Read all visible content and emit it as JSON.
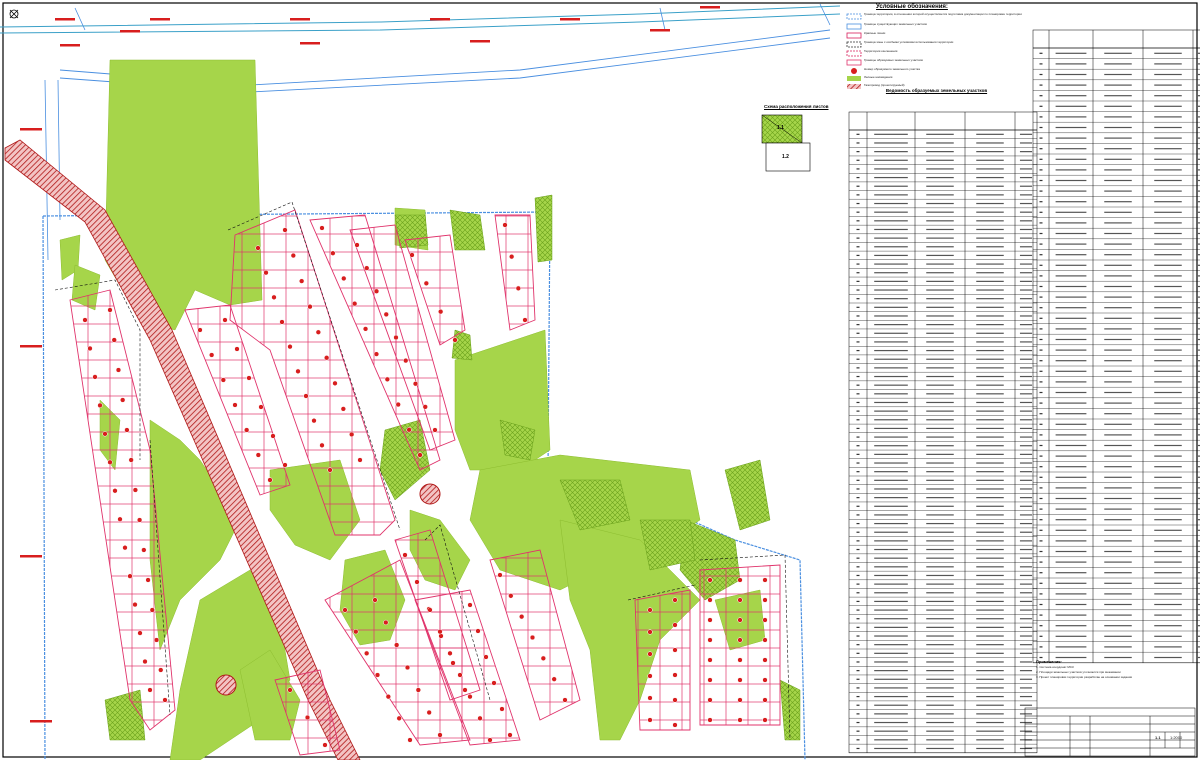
{
  "legend": {
    "title": "Условные обозначения:",
    "items": [
      {
        "label": "Граница территории, в отношении которой осуществляется подготовка документации по планировке территории",
        "kind": "boundary"
      },
      {
        "label": "Границы существующих земельных участков",
        "kind": "cadastral"
      },
      {
        "label": "Красные линии",
        "kind": "red-line"
      },
      {
        "label": "Граница зоны с особыми условиями использования территории",
        "kind": "zone"
      },
      {
        "label": "Территория озеленения",
        "kind": "zone2"
      },
      {
        "label": "Границы образуемых земельных участков",
        "kind": "parcel"
      },
      {
        "label": "Номер образуемого земельного участка",
        "kind": "marker"
      },
      {
        "label": "Лесные насаждения",
        "kind": "forest"
      },
      {
        "label": "Газопровод (проектируемый)",
        "kind": "gas"
      }
    ]
  },
  "table_a": {
    "title": "Ведомость образуемых земельных участков",
    "rows": 72
  },
  "table_b": {
    "rows": 58
  },
  "scheme": {
    "title": "Схема расположения листов",
    "sheet1": "1.1",
    "sheet2": "1.2"
  },
  "notes": {
    "title": "Примечания:",
    "lines": [
      "1. Система координат МСК",
      "2. Площади земельных участков уточняются при межевании",
      "3. Проект планировки территории разработан на основании задания"
    ]
  },
  "title_block": {
    "sheet": "1.1",
    "scale": "1:2000"
  },
  "colors": {
    "forest": "#9ed03c",
    "red_line": "#d81e5b",
    "boundary": "#4a8fe0",
    "road": "#b01818"
  },
  "icons": {
    "compass": "compass-icon"
  }
}
